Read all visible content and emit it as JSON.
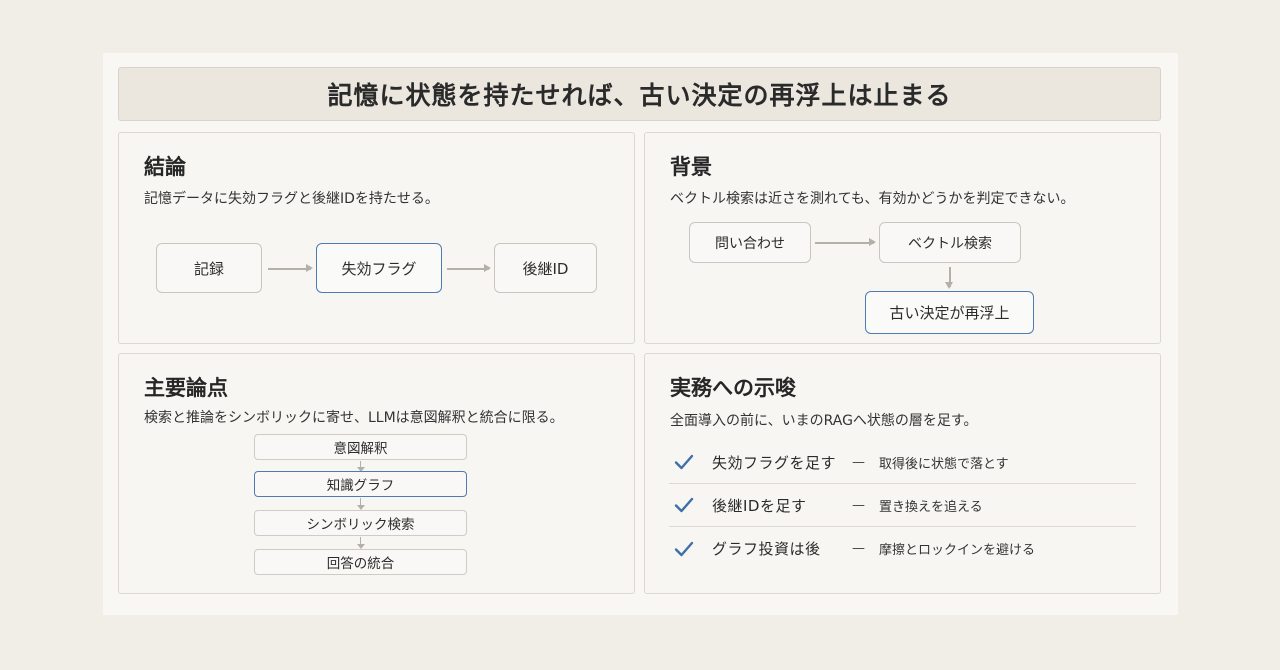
{
  "title": "記憶に状態を持たせれば、古い決定の再浮上は止まる",
  "conclusion": {
    "heading": "結論",
    "subtitle": "記憶データに失効フラグと後継IDを持たせる。",
    "flow": [
      "記録",
      "失効フラグ",
      "後継ID"
    ]
  },
  "background": {
    "heading": "背景",
    "subtitle": "ベクトル検索は近さを測れても、有効かどうかを判定できない。",
    "flow": [
      "問い合わせ",
      "ベクトル検索",
      "古い決定が再浮上"
    ]
  },
  "key_points": {
    "heading": "主要論点",
    "subtitle": "検索と推論をシンボリックに寄せ、LLMは意図解釈と統合に限る。",
    "steps": [
      "意図解釈",
      "知識グラフ",
      "シンボリック検索",
      "回答の統合"
    ]
  },
  "implications": {
    "heading": "実務への示唆",
    "subtitle": "全面導入の前に、いまのRAGへ状態の層を足す。",
    "items": [
      {
        "label": "失効フラグを足す",
        "dash": "—",
        "detail": "取得後に状態で落とす"
      },
      {
        "label": "後継IDを足す",
        "dash": "—",
        "detail": "置き換えを追える"
      },
      {
        "label": "グラフ投資は後",
        "dash": "—",
        "detail": "摩擦とロックインを避ける"
      }
    ]
  },
  "colors": {
    "accent": "#4d7cb5",
    "check": "#3f6fa8",
    "background": "#f1eee8",
    "title_bar": "#ebe6de"
  }
}
